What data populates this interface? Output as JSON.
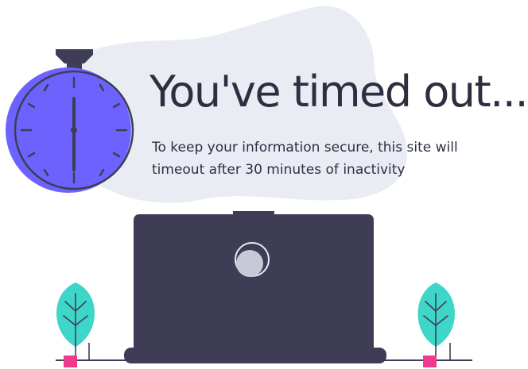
{
  "page": {
    "title": "You've timed out...",
    "message": "To keep your information secure, this site will timeout after 30 minutes of inactivity"
  },
  "colors": {
    "text": "#2f2e41",
    "accent_purple": "#6c63ff",
    "dark_ink": "#3f3d56",
    "blob_background": "#eaecf4",
    "leaf_teal": "#3ed6c8",
    "pot_pink": "#ee3a8c"
  },
  "icons": {
    "stopwatch": "stopwatch-icon",
    "laptop": "laptop-icon",
    "laptop_logo": "laptop-logo-icon",
    "plant": "plant-icon"
  }
}
